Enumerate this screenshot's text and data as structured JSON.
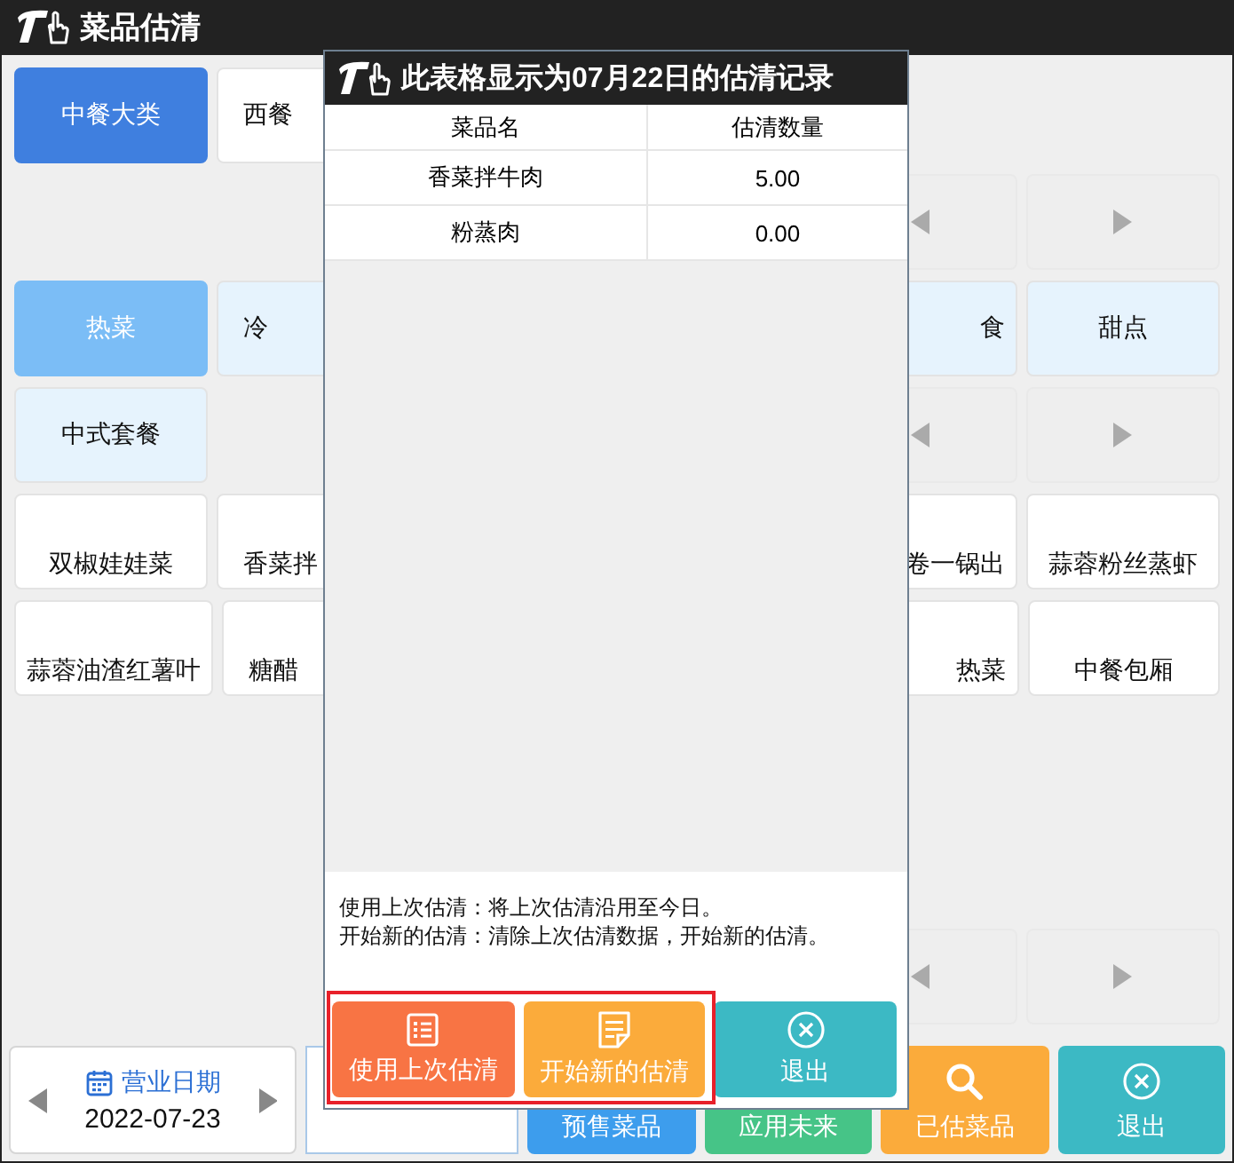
{
  "window": {
    "title": "菜品估清"
  },
  "grid": [
    {
      "cells": [
        {
          "kind": "category",
          "label": "中餐大类",
          "selected": true
        },
        {
          "kind": "category",
          "label": "西餐",
          "selected": false
        },
        null,
        null,
        null,
        null
      ]
    },
    {
      "cells": [
        null,
        null,
        null,
        null,
        {
          "kind": "prev"
        },
        {
          "kind": "next"
        }
      ]
    },
    {
      "cells": [
        {
          "kind": "subcategory",
          "label": "热菜",
          "selected": true
        },
        {
          "kind": "subcategory",
          "label": "冷",
          "selected": false
        },
        null,
        null,
        {
          "kind": "subcategory",
          "label": "食",
          "selected": false
        },
        {
          "kind": "subcategory",
          "label": "甜点",
          "selected": false
        }
      ]
    },
    {
      "cells": [
        {
          "kind": "subcategory",
          "label": "中式套餐",
          "selected": false
        },
        null,
        null,
        null,
        {
          "kind": "prev"
        },
        {
          "kind": "next"
        }
      ]
    },
    {
      "cells": [
        {
          "kind": "dish",
          "label": "双椒娃娃菜"
        },
        {
          "kind": "dish",
          "label": "香菜拌"
        },
        null,
        null,
        {
          "kind": "dish",
          "label": "卷一锅出"
        },
        {
          "kind": "dish",
          "label": "蒜蓉粉丝蒸虾"
        }
      ]
    },
    {
      "cells": [
        {
          "kind": "dish",
          "label": "蒜蓉油渣红薯叶"
        },
        {
          "kind": "dish",
          "label": "糖醋"
        },
        null,
        null,
        {
          "kind": "dish",
          "label": "热菜"
        },
        {
          "kind": "dish",
          "label": "中餐包厢"
        }
      ]
    },
    {
      "cells": [
        null,
        null,
        null,
        null,
        {
          "kind": "prev"
        },
        {
          "kind": "next"
        }
      ]
    }
  ],
  "bottom_bar": {
    "date": {
      "label": "营业日期",
      "value": "2022-07-23"
    },
    "buttons": [
      {
        "kind": "presale",
        "label": "预售菜品"
      },
      {
        "kind": "apply",
        "label": "应用未来"
      },
      {
        "kind": "estimated",
        "label": "已估菜品"
      },
      {
        "kind": "exit",
        "label": "退出"
      }
    ]
  },
  "dialog": {
    "title": "此表格显示为07月22日的估清记录",
    "columns": [
      "菜品名",
      "估清数量"
    ],
    "rows": [
      {
        "name": "香菜拌牛肉",
        "quantity": "5.00"
      },
      {
        "name": "粉蒸肉",
        "quantity": "0.00"
      }
    ],
    "notes": [
      "使用上次估清：将上次估清沿用至今日。",
      "开始新的估清：清除上次估清数据，开始新的估清。"
    ],
    "buttons": [
      {
        "kind": "use_last",
        "label": "使用上次估清"
      },
      {
        "kind": "start_new",
        "label": "开始新的估清"
      },
      {
        "kind": "exit",
        "label": "退出"
      }
    ]
  }
}
